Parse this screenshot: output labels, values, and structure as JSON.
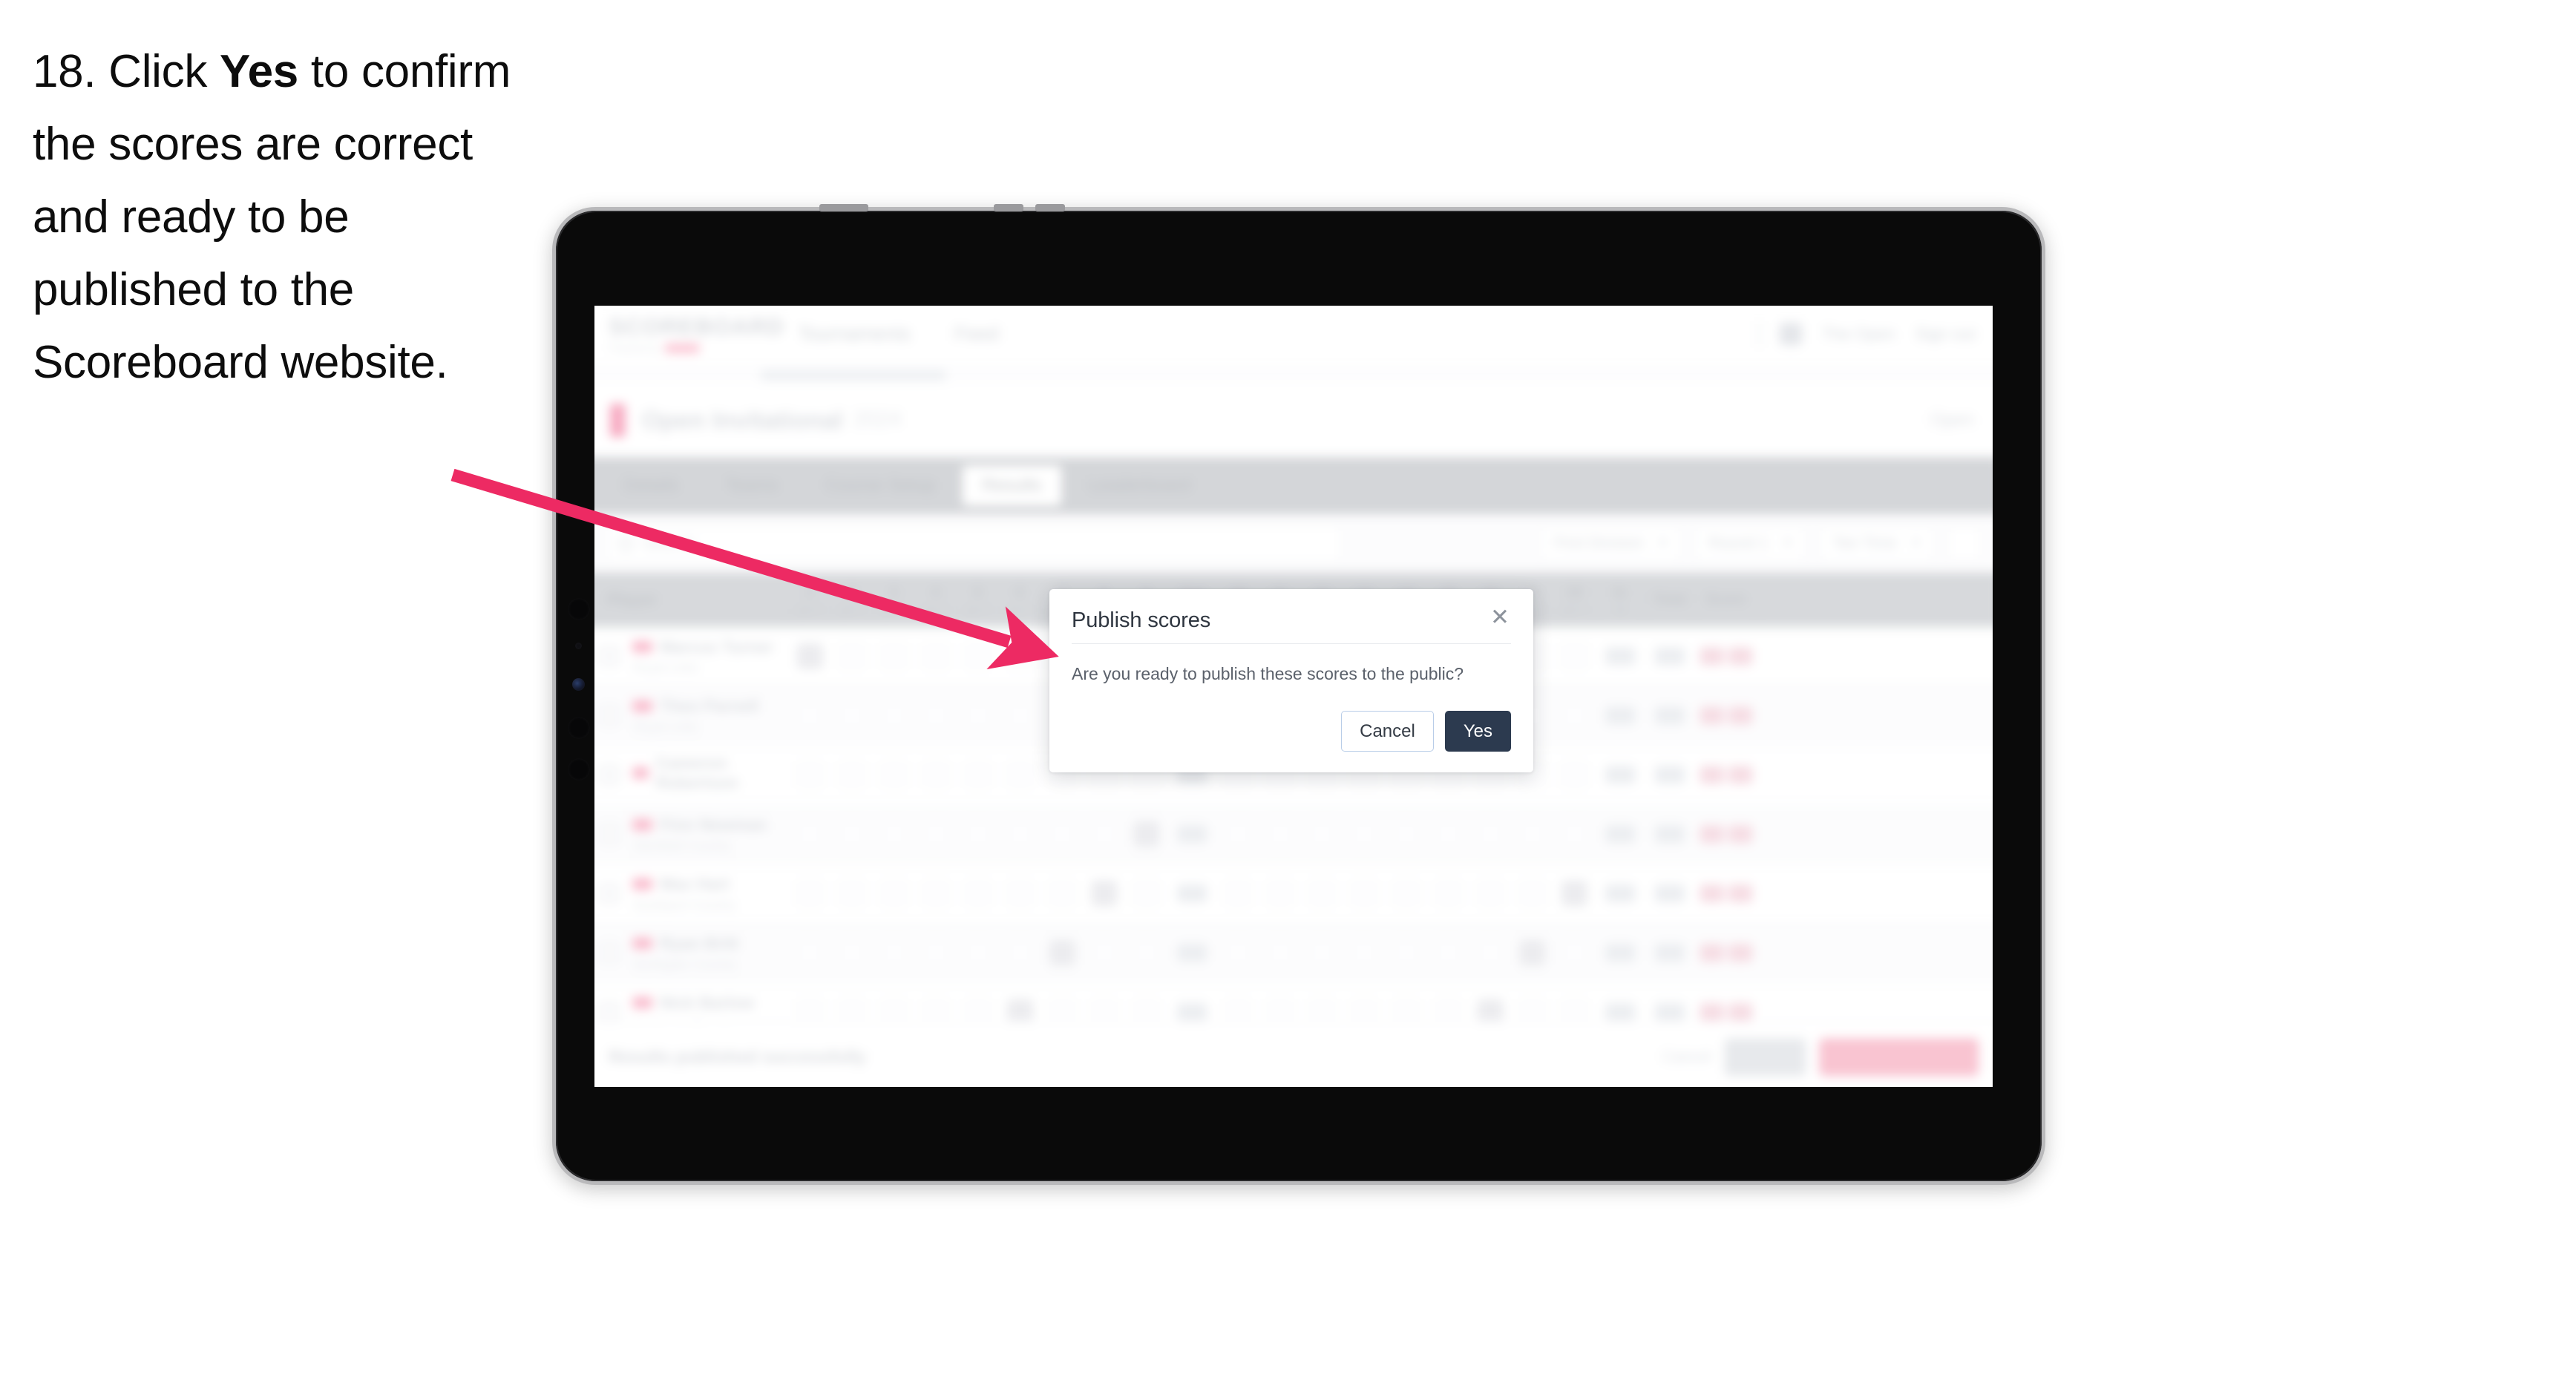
{
  "instruction": {
    "step_number": "18.",
    "text_before": " Click ",
    "bold_word": "Yes",
    "text_after": " to confirm the scores are correct and ready to be published to the Scoreboard website."
  },
  "annotation": {
    "arrow_color": "#ED2A63",
    "points_to": "yes-button"
  },
  "device": {
    "type": "tablet",
    "orientation": "landscape",
    "frame_color": "#0a0a0a",
    "bezel_color": "#b9b9bb"
  },
  "app": {
    "blurred": true,
    "header": {
      "logo": "SCOREBOARD",
      "logo_sub": "Powered by",
      "nav": [
        {
          "label": "Tournaments"
        },
        {
          "label": "Feed"
        }
      ],
      "right": [
        {
          "label": "The Open",
          "icon": "avatar-icon"
        },
        {
          "label": "Sign out"
        }
      ]
    },
    "title_bar": {
      "tournament": "Open Invitational",
      "year": "2024",
      "right_action": "Open"
    },
    "tabs": [
      {
        "label": "Details",
        "active": false
      },
      {
        "label": "Teams",
        "active": false
      },
      {
        "label": "Course Setup",
        "active": false
      },
      {
        "label": "Results",
        "active": true
      },
      {
        "label": "Leaderboard",
        "active": false
      }
    ],
    "filters": {
      "search_placeholder": "Search",
      "dropdowns": [
        {
          "label": "First Division"
        },
        {
          "label": "Round 1"
        },
        {
          "label": "Tee Time"
        }
      ],
      "icon_button": "filter-icon"
    },
    "table": {
      "columns": [
        {
          "label": "Player",
          "sub": "",
          "type": "player"
        },
        {
          "label": "1",
          "sub": "par 4",
          "type": "hole"
        },
        {
          "label": "2",
          "sub": "par 3",
          "type": "hole"
        },
        {
          "label": "3",
          "sub": "par 5",
          "type": "hole"
        },
        {
          "label": "4",
          "sub": "par 4",
          "type": "hole"
        },
        {
          "label": "5",
          "sub": "par 4",
          "type": "hole"
        },
        {
          "label": "6",
          "sub": "par 3",
          "type": "hole"
        },
        {
          "label": "7",
          "sub": "par 4",
          "type": "hole"
        },
        {
          "label": "8",
          "sub": "par 5",
          "type": "hole"
        },
        {
          "label": "9",
          "sub": "par 4",
          "type": "hole"
        },
        {
          "label": "Out",
          "sub": "36",
          "type": "sum"
        },
        {
          "label": "10",
          "sub": "par 4",
          "type": "hole"
        },
        {
          "label": "11",
          "sub": "par 3",
          "type": "hole"
        },
        {
          "label": "12",
          "sub": "par 5",
          "type": "hole"
        },
        {
          "label": "13",
          "sub": "par 4",
          "type": "hole"
        },
        {
          "label": "14",
          "sub": "par 4",
          "type": "hole"
        },
        {
          "label": "15",
          "sub": "par 3",
          "type": "hole"
        },
        {
          "label": "16",
          "sub": "par 4",
          "type": "hole"
        },
        {
          "label": "17",
          "sub": "par 5",
          "type": "hole"
        },
        {
          "label": "18",
          "sub": "par 4",
          "type": "hole"
        },
        {
          "label": "In",
          "sub": "36",
          "type": "sum"
        },
        {
          "label": "Total",
          "sub": "",
          "type": "sum"
        },
        {
          "label": "Score",
          "sub": "",
          "type": "total"
        }
      ],
      "rows": [
        {
          "name": "Marcus Turner",
          "club": "Royal Links"
        },
        {
          "name": "Theo Parnell",
          "club": "Royal Links"
        },
        {
          "name": "Cameron Robertson",
          "club": ""
        },
        {
          "name": "Finn Newman",
          "club": "Glenfield Country"
        },
        {
          "name": "Max Hart",
          "club": "Southport Country"
        },
        {
          "name": "Ryan Britt",
          "club": "Northgate Country"
        },
        {
          "name": "Nick Barlow",
          "club": "Northgate Country"
        }
      ]
    },
    "bottom_bar": {
      "status": "Results published successfully",
      "link": "Cancel",
      "secondary_button": "Save all",
      "primary_button": "Publish to Scoreboard"
    }
  },
  "dialog": {
    "title": "Publish scores",
    "close_icon": "close-icon",
    "message": "Are you ready to publish these scores to the public?",
    "cancel_label": "Cancel",
    "confirm_label": "Yes",
    "confirm_bg": "#2c3a4f",
    "cancel_border": "#b9cde8"
  }
}
